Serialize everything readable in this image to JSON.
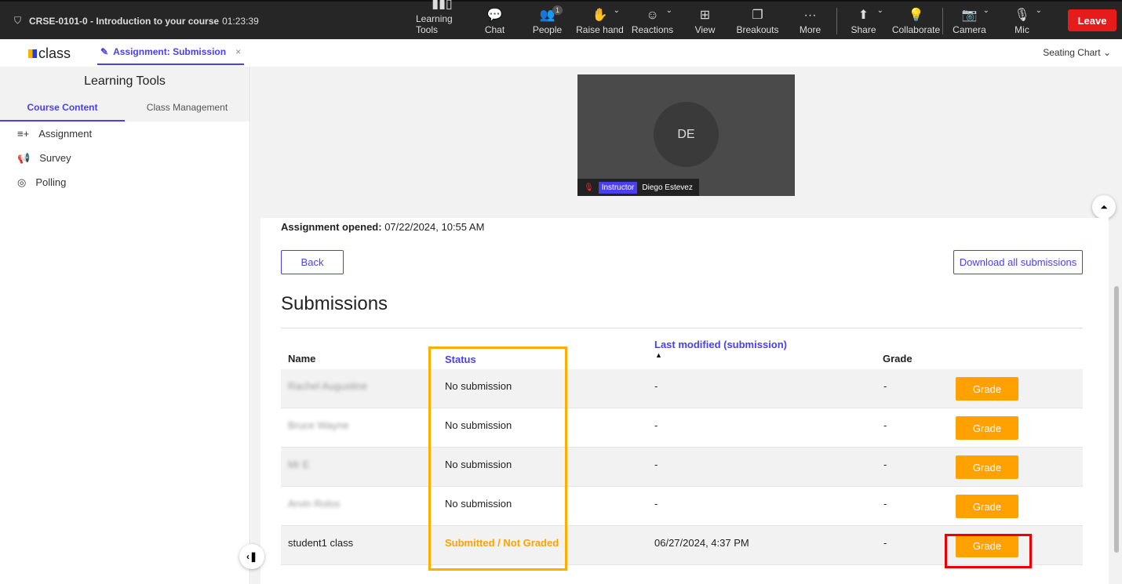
{
  "topbar": {
    "meeting_title": "CRSE-0101-0 - Introduction to your course",
    "timer": "01:23:39",
    "tools": [
      {
        "label": "Learning Tools",
        "icon": "bar-chart-icon"
      },
      {
        "label": "Chat",
        "icon": "chat-icon"
      },
      {
        "label": "People",
        "icon": "people-icon",
        "badge": "1"
      },
      {
        "label": "Raise hand",
        "icon": "hand-icon"
      },
      {
        "label": "Reactions",
        "icon": "smiley-icon"
      },
      {
        "label": "View",
        "icon": "layout-icon"
      },
      {
        "label": "Breakouts",
        "icon": "breakouts-icon"
      },
      {
        "label": "More",
        "icon": "more-icon"
      },
      {
        "label": "Share",
        "icon": "share-icon"
      },
      {
        "label": "Collaborate",
        "icon": "lightbulb-icon"
      },
      {
        "label": "Camera",
        "icon": "camera-off-icon"
      },
      {
        "label": "Mic",
        "icon": "mic-off-icon"
      }
    ],
    "leave_label": "Leave"
  },
  "tabbar": {
    "logo": "class",
    "tab_label": "Assignment: Submission",
    "close": "×",
    "seating_chart": "Seating Chart"
  },
  "sidebar": {
    "title": "Learning Tools",
    "tabs": [
      "Course Content",
      "Class Management"
    ],
    "items": [
      "Assignment",
      "Survey",
      "Polling"
    ]
  },
  "video": {
    "initials": "DE",
    "role": "Instructor",
    "name": "Diego Estevez"
  },
  "panel": {
    "opened_label": "Assignment opened:",
    "opened_value": "07/22/2024, 10:55 AM",
    "back": "Back",
    "download": "Download all submissions",
    "heading": "Submissions",
    "columns": {
      "name": "Name",
      "status": "Status",
      "modified": "Last modified (submission)",
      "grade": "Grade"
    },
    "grade_button": "Grade",
    "rows": [
      {
        "name": "Rachel Augustine",
        "status": "No submission",
        "modified": "-",
        "grade": "-",
        "blurred": true
      },
      {
        "name": "Bruce Wayne",
        "status": "No submission",
        "modified": "-",
        "grade": "-",
        "blurred": true
      },
      {
        "name": "Mr E",
        "status": "No submission",
        "modified": "-",
        "grade": "-",
        "blurred": true
      },
      {
        "name": "Arvin Rolos",
        "status": "No submission",
        "modified": "-",
        "grade": "-",
        "blurred": true
      },
      {
        "name": "student1 class",
        "status": "Submitted / Not Graded",
        "modified": "06/27/2024, 4:37 PM",
        "grade": "-",
        "blurred": false
      }
    ]
  },
  "colors": {
    "accent": "#4a3ff0",
    "grade": "#ffa100",
    "leave": "#e61c1c",
    "highlight_status": "#ffad00",
    "highlight_grade": "#e00000"
  }
}
